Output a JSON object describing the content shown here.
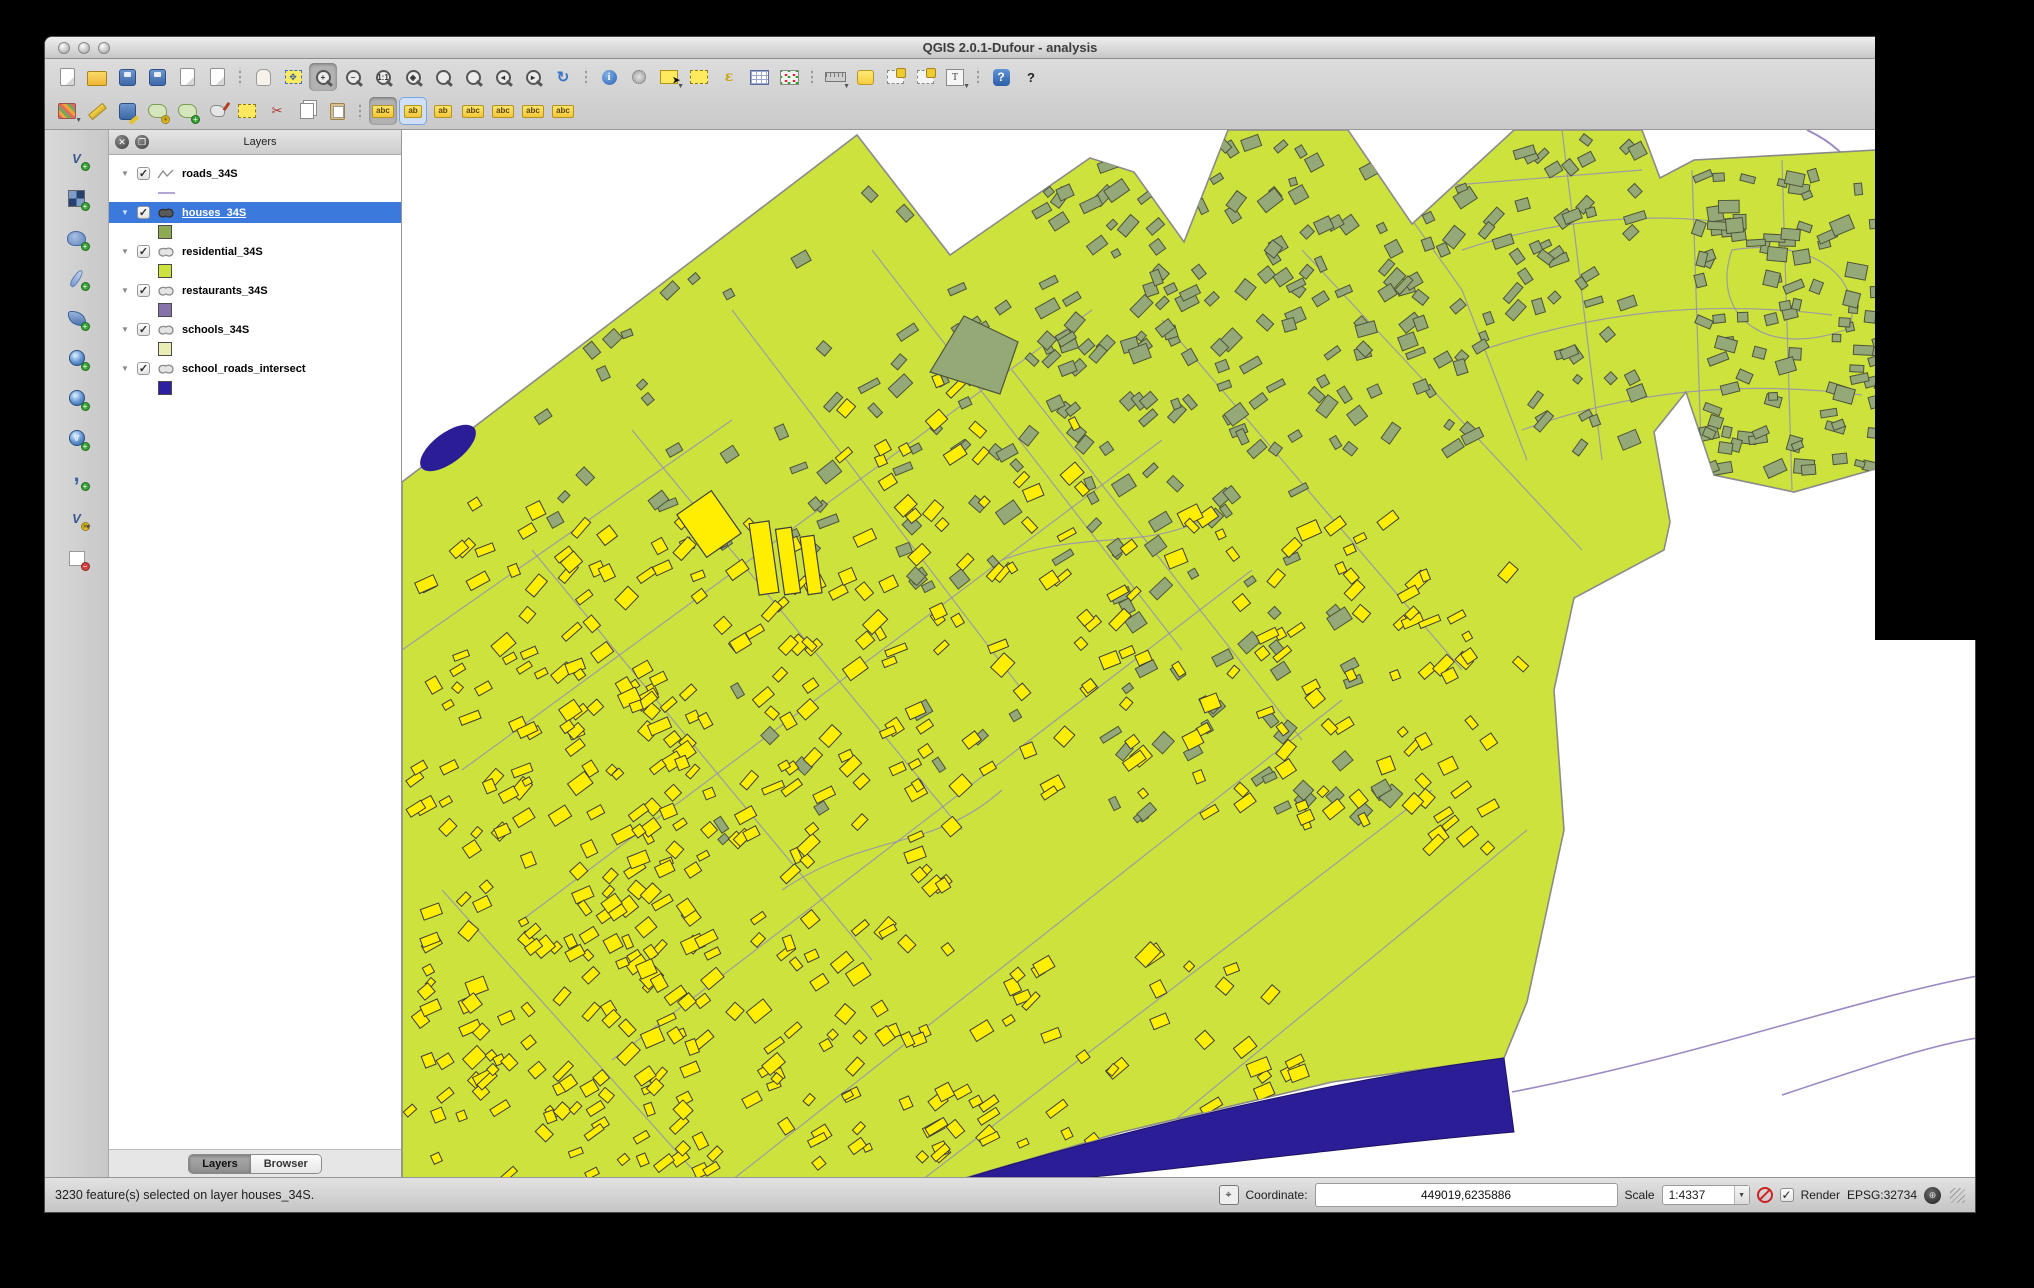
{
  "window": {
    "title": "QGIS 2.0.1-Dufour - analysis"
  },
  "titlebar": {
    "buttons": [
      "close-window-button",
      "minimize-window-button",
      "zoom-window-button"
    ]
  },
  "toolbar_row1": [
    {
      "name": "new-project",
      "shape": "doc"
    },
    {
      "name": "open-project",
      "shape": "folder"
    },
    {
      "name": "save-project",
      "shape": "floppy"
    },
    {
      "name": "save-project-as",
      "shape": "floppy"
    },
    {
      "name": "new-print-composer",
      "shape": "doc"
    },
    {
      "name": "composer-manager",
      "shape": "doc"
    },
    {
      "sep": true
    },
    {
      "name": "pan-map",
      "shape": "hand"
    },
    {
      "name": "pan-to-selection",
      "shape": "pansel",
      "text": "✥"
    },
    {
      "name": "zoom-in",
      "shape": "mag",
      "text": "+",
      "active": "pressed"
    },
    {
      "name": "zoom-out",
      "shape": "mag",
      "text": "−"
    },
    {
      "name": "zoom-native",
      "shape": "mag",
      "text": "1:1"
    },
    {
      "name": "zoom-full",
      "shape": "mag bfill",
      "text": "◈"
    },
    {
      "name": "zoom-to-selection",
      "shape": "mag yfill"
    },
    {
      "name": "zoom-to-layer",
      "shape": "mag"
    },
    {
      "name": "zoom-last",
      "shape": "mag",
      "text": "◂"
    },
    {
      "name": "zoom-next",
      "shape": "mag",
      "text": "▸"
    },
    {
      "name": "refresh-map",
      "shape": "refresh",
      "text": "↻"
    },
    {
      "sep": true
    },
    {
      "name": "identify-features",
      "shape": "info",
      "text": "i"
    },
    {
      "name": "run-feature-action",
      "shape": "gear"
    },
    {
      "name": "select-features",
      "shape": "selrect",
      "cursor": true,
      "carret": false,
      "caret": true
    },
    {
      "name": "deselect-features",
      "shape": "dashrect"
    },
    {
      "name": "select-by-expression",
      "shape": "eps",
      "text": "ε"
    },
    {
      "name": "open-attribute-table",
      "shape": "table"
    },
    {
      "name": "field-calculator",
      "shape": "abacus"
    },
    {
      "sep": true
    },
    {
      "name": "measure-line",
      "shape": "ruler",
      "caret": true
    },
    {
      "name": "new-bookmark",
      "shape": "bookmark"
    },
    {
      "name": "show-bookmarks",
      "shape": "bmdash"
    },
    {
      "name": "zoom-to-bookmark",
      "shape": "bmdash"
    },
    {
      "name": "text-annotation",
      "shape": "tbox",
      "text": "T",
      "caret": true
    },
    {
      "sep": true
    },
    {
      "name": "help-contents",
      "shape": "help",
      "text": "?"
    },
    {
      "name": "whats-this",
      "shape": "whats",
      "text": "?",
      "cursorarrow": true
    }
  ],
  "toolbar_row2": [
    {
      "name": "current-edits",
      "shape": "pencils",
      "caret": true
    },
    {
      "name": "toggle-editing",
      "shape": "pencil"
    },
    {
      "name": "save-layer-edits",
      "shape": "saveedits"
    },
    {
      "name": "add-feature",
      "shape": "blob",
      "badge": "yellow"
    },
    {
      "name": "move-feature",
      "shape": "blob",
      "badge": "blue"
    },
    {
      "name": "node-tool",
      "shape": "node"
    },
    {
      "name": "delete-selected",
      "shape": "dashrect"
    },
    {
      "name": "cut-features",
      "shape": "cut",
      "text": "✂"
    },
    {
      "name": "copy-features",
      "shape": "copy"
    },
    {
      "name": "paste-features",
      "shape": "paste"
    },
    {
      "sep": true
    },
    {
      "name": "labeling",
      "shape": "tag",
      "text": "abc",
      "active": "pressed"
    },
    {
      "name": "pin-label",
      "shape": "tag pin",
      "text": "ab",
      "active": "blue"
    },
    {
      "name": "unpin-label",
      "shape": "tag pin",
      "text": "ab"
    },
    {
      "name": "show-hide-labels",
      "shape": "tag",
      "text": "abc"
    },
    {
      "name": "move-label",
      "shape": "tag",
      "text": "abc"
    },
    {
      "name": "rotate-label",
      "shape": "tag",
      "text": "abc"
    },
    {
      "name": "change-label",
      "shape": "tag",
      "text": "abc"
    }
  ],
  "left_toolbar": [
    {
      "name": "add-vector-layer",
      "shape": "vglyph",
      "text": "V",
      "badge": "green"
    },
    {
      "name": "add-raster-layer",
      "shape": "check",
      "badge": "green"
    },
    {
      "name": "add-postgis-layer",
      "shape": "elephant",
      "badge": "green"
    },
    {
      "name": "add-spatialite-layer",
      "shape": "feather",
      "badge": "green"
    },
    {
      "name": "add-mssql-layer",
      "shape": "shell",
      "badge": "green"
    },
    {
      "name": "add-wms-layer",
      "shape": "globe",
      "badge": "green"
    },
    {
      "name": "add-wcs-layer",
      "shape": "globe",
      "badge": "green"
    },
    {
      "name": "add-wfs-layer",
      "shape": "globe",
      "text": "V",
      "badge": "green"
    },
    {
      "name": "add-delimited-text-layer",
      "shape": "comma",
      "text": ",",
      "badge": "green"
    },
    {
      "name": "new-shapefile-layer",
      "shape": "vglyph",
      "text": "V",
      "badge": "yellow",
      "caret": true
    },
    {
      "name": "remove-layer",
      "shape": "sqred",
      "badge": "red"
    }
  ],
  "layers_panel": {
    "title": "Layers",
    "header_buttons": [
      "close-panel-button",
      "float-panel-button"
    ],
    "tabs": [
      {
        "label": "Layers",
        "active": true
      },
      {
        "label": "Browser",
        "active": false
      }
    ],
    "layers": [
      {
        "name": "roads_34S",
        "checked": true,
        "selected": false,
        "type": "line",
        "swatch": "#b5a6d8"
      },
      {
        "name": "houses_34S",
        "checked": true,
        "selected": true,
        "type": "polygon",
        "swatch": "#90a955"
      },
      {
        "name": "residential_34S",
        "checked": true,
        "selected": false,
        "type": "polygon",
        "swatch": "#cde23d"
      },
      {
        "name": "restaurants_34S",
        "checked": true,
        "selected": false,
        "type": "polygon",
        "swatch": "#8673aa"
      },
      {
        "name": "schools_34S",
        "checked": true,
        "selected": false,
        "type": "polygon",
        "swatch": "#e9edb6"
      },
      {
        "name": "school_roads_intersect",
        "checked": true,
        "selected": false,
        "type": "polygon",
        "swatch": "#2b1fa2"
      }
    ]
  },
  "statusbar": {
    "message": "3230 feature(s) selected on layer houses_34S.",
    "coordinate_label": "Coordinate:",
    "coordinate_value": "449019,6235886",
    "scale_label": "Scale",
    "scale_value": "1:4337",
    "render_label": "Render",
    "render_checked": true,
    "epsg_label": "EPSG:32734"
  },
  "map": {
    "colors": {
      "background": "#ffffff",
      "residential": "#cde23d",
      "residential_outline": "#8a8a8a",
      "house_olive": "#95a878",
      "house_olive_outline": "#4c5438",
      "house_selected": "#ffee00",
      "house_selected_outline": "#3d3d3d",
      "road": "#978fb2",
      "river": "#2a1d96",
      "external_stream": "#9b8bc4"
    }
  }
}
